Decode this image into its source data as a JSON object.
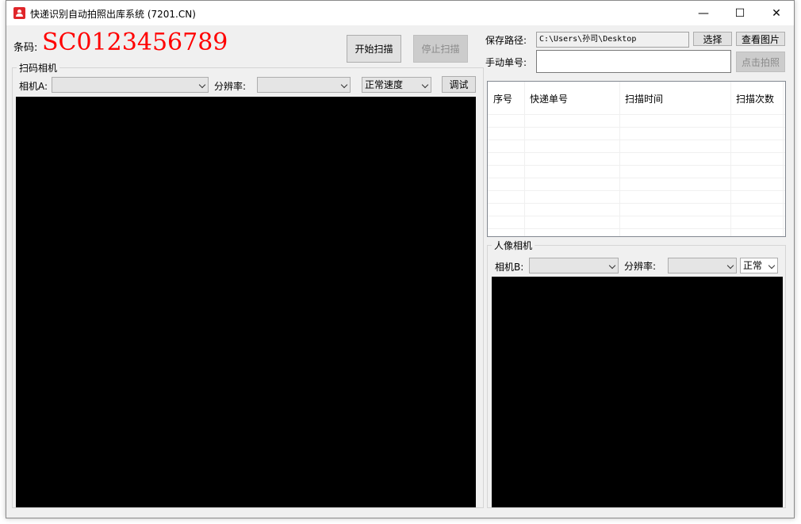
{
  "window": {
    "title": "快递识别自动拍照出库系统 (7201.CN)",
    "minimize_glyph": "—",
    "maximize_glyph": "☐",
    "close_glyph": "✕",
    "app_icon": "user-icon",
    "app_icon_color": "#e0262a"
  },
  "barcode": {
    "label": "条码:",
    "value": "SC0123456789",
    "value_color": "#ff0000"
  },
  "actions": {
    "start_scan": "开始扫描",
    "stop_scan": "停止扫描"
  },
  "save": {
    "label": "保存路径:",
    "path": "C:\\Users\\孙司\\Desktop",
    "choose_button": "选择",
    "view_images_button": "查看图片"
  },
  "manual": {
    "label": "手动单号:",
    "value": "",
    "capture_button": "点击拍照"
  },
  "scan_camera": {
    "group_title": "扫码相机",
    "camera_label": "相机A:",
    "camera_value": "",
    "resolution_label": "分辨率:",
    "resolution_value": "",
    "speed_value": "正常速度",
    "debug_button": "调试"
  },
  "table": {
    "columns": [
      "序号",
      "快递单号",
      "扫描时间",
      "扫描次数"
    ],
    "rows": []
  },
  "portrait_camera": {
    "group_title": "人像相机",
    "camera_label": "相机B:",
    "camera_value": "",
    "resolution_label": "分辨率:",
    "resolution_value": "",
    "speed_value": "正常"
  }
}
